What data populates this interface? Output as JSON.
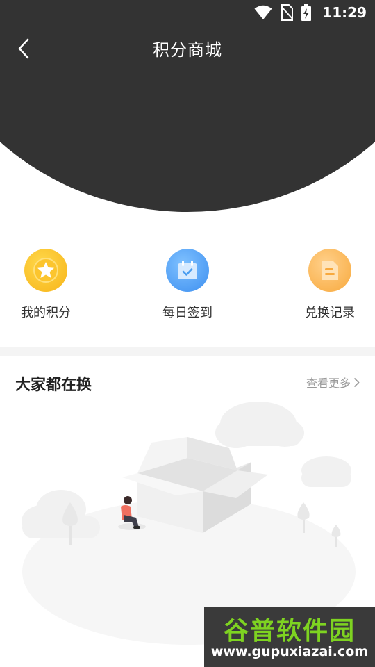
{
  "status_bar": {
    "time": "11:29"
  },
  "header": {
    "title": "积分商城"
  },
  "shortcuts": [
    {
      "label": "我的积分",
      "icon": "star-coin-icon",
      "color": "#f8b81e"
    },
    {
      "label": "每日签到",
      "icon": "calendar-check-icon",
      "color": "#4a9df0"
    },
    {
      "label": "兑换记录",
      "icon": "document-icon",
      "color": "#f9b24a"
    }
  ],
  "section": {
    "title": "大家都在换",
    "more_label": "查看更多"
  },
  "watermark": {
    "brand": "谷普软件园",
    "url": "www.gupuxiazai.com"
  },
  "colors": {
    "header_bg": "#333333",
    "divider": "#f4f4f4"
  }
}
